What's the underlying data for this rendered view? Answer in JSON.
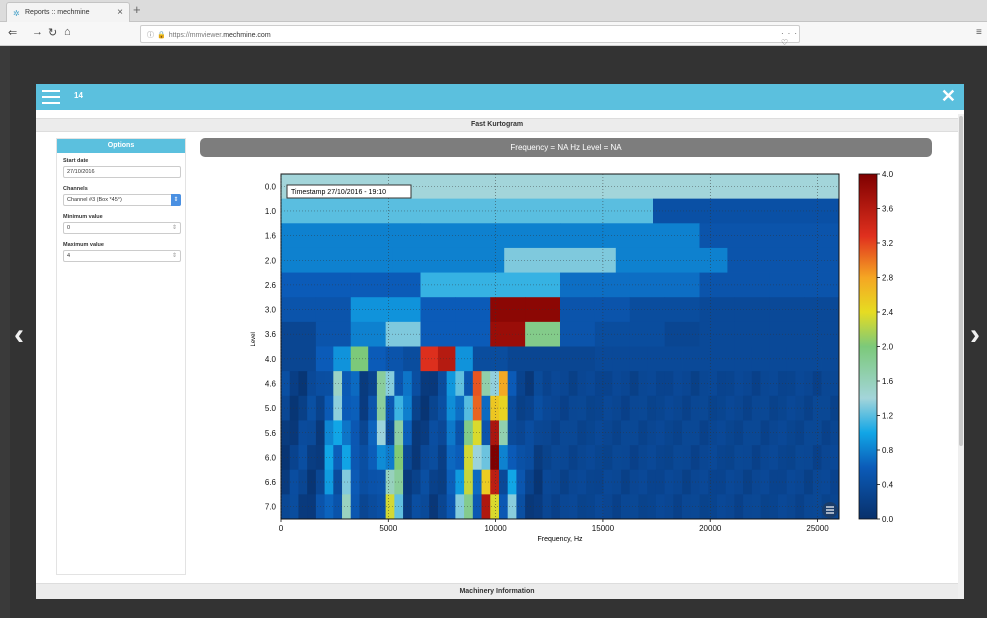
{
  "browser": {
    "tab_title": "Reports :: mechmine",
    "url_prefix": "https://mmviewer.",
    "url_domain": "mechmine.com",
    "toolbar_icons": "··· ♡ ☆"
  },
  "modal": {
    "number": "14",
    "section_title": "Fast Kurtogram",
    "footer_section_title": "Machinery Information"
  },
  "options": {
    "title": "Options",
    "start_date_label": "Start date",
    "start_date_value": "27/10/2016",
    "channels_label": "Channels",
    "channels_value": "Channel #3 (Box *45°)",
    "min_label": "Minimum value",
    "min_value": "0",
    "max_label": "Maximum value",
    "max_value": "4"
  },
  "chart_header": "Frequency = NA Hz     Level = NA",
  "chart_data": {
    "type": "heatmap",
    "timestamp": "Timestamp 27/10/2016 - 19:10",
    "xlabel": "Frequency, Hz",
    "ylabel": "Level",
    "xlim": [
      0,
      26000
    ],
    "xticks": [
      0,
      5000,
      10000,
      15000,
      20000,
      25000
    ],
    "ytick_labels": [
      "0.0",
      "1.0",
      "1.6",
      "2.0",
      "2.6",
      "3.0",
      "3.6",
      "4.0",
      "4.6",
      "5.0",
      "5.6",
      "6.0",
      "6.6",
      "7.0"
    ],
    "colorbar_range": [
      0.0,
      4.0
    ],
    "colorbar_ticks": [
      "4.0",
      "3.6",
      "3.2",
      "2.8",
      "2.4",
      "2.0",
      "1.6",
      "1.2",
      "0.8",
      "0.4",
      "0.0"
    ],
    "rows": [
      [
        1.4
      ],
      [
        1.2,
        1.2,
        0.45
      ],
      [
        0.8,
        0.8,
        0.8,
        0.5
      ],
      [
        0.8,
        0.8,
        1.3,
        0.8,
        0.5
      ],
      [
        0.6,
        0.6,
        1.1,
        1.1,
        0.7,
        0.7,
        0.5,
        0.5
      ],
      [
        0.5,
        0.5,
        0.9,
        0.9,
        0.6,
        0.6,
        3.9,
        3.9,
        0.5,
        0.5,
        0.4,
        0.4,
        0.35,
        0.35,
        0.35,
        0.35
      ],
      [
        0.3,
        0.5,
        0.8,
        1.3,
        0.6,
        0.6,
        3.8,
        1.9,
        0.5,
        0.4,
        0.4,
        0.3,
        0.35,
        0.35,
        0.35,
        0.35
      ],
      [
        0.3,
        0.3,
        0.6,
        0.9,
        2.0,
        0.6,
        0.5,
        0.4,
        3.3,
        3.6,
        0.9,
        0.4,
        0.4,
        0.3,
        0.3,
        0.3,
        0.3,
        0.3,
        0.35,
        0.35,
        0.35,
        0.35,
        0.35,
        0.35,
        0.35,
        0.35,
        0.35,
        0.35,
        0.35,
        0.35,
        0.35,
        0.35
      ]
    ]
  },
  "icons": {
    "menu": "hamburger-icon",
    "close": "close-icon",
    "prev": "chevron-left-icon",
    "next": "chevron-right-icon",
    "chart_menu": "chart-menu-icon"
  },
  "colors": {
    "accent": "#5bc0de",
    "header_bar": "#7d7d7d"
  }
}
